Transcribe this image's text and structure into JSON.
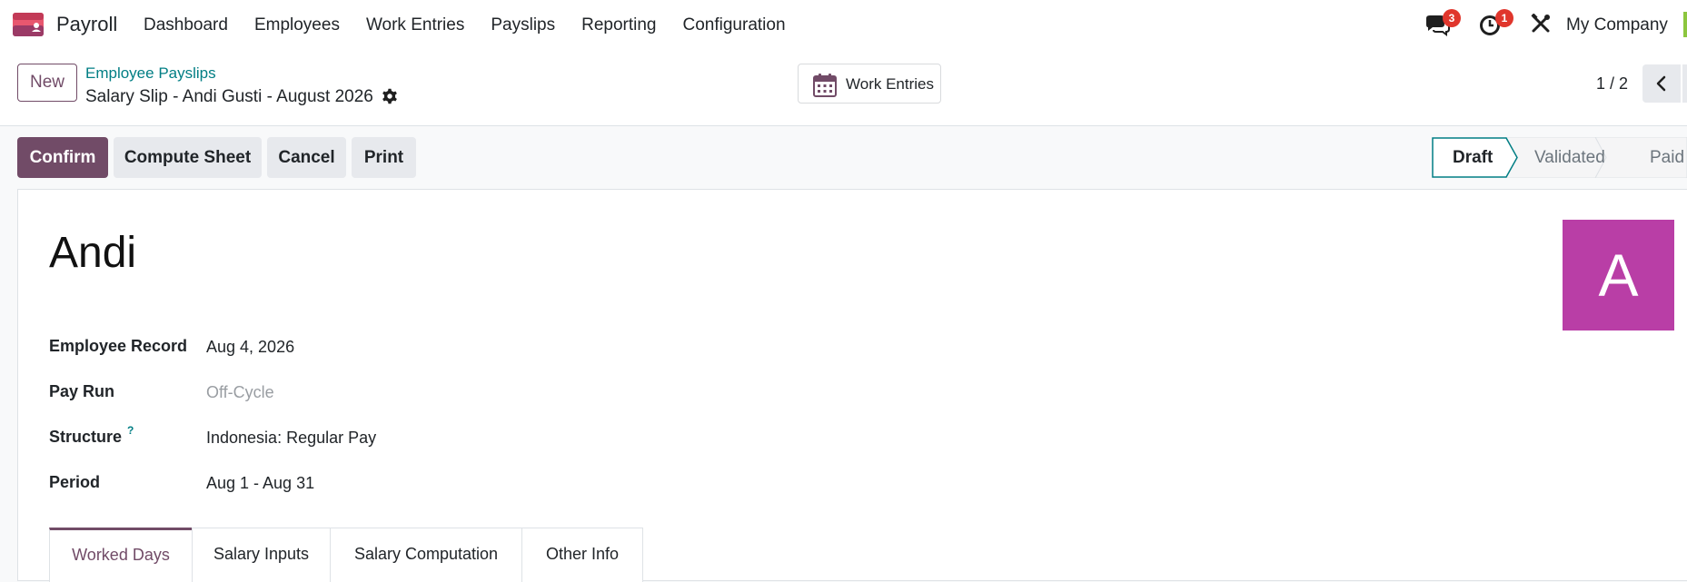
{
  "navbar": {
    "app_name": "Payroll",
    "menu": [
      "Dashboard",
      "Employees",
      "Work Entries",
      "Payslips",
      "Reporting",
      "Configuration"
    ],
    "messages_badge": "3",
    "activities_badge": "1",
    "company": "My Company",
    "icons": [
      "payroll-app-icon",
      "chat-icon",
      "clock-icon",
      "tools-icon"
    ]
  },
  "control_panel": {
    "new_label": "New",
    "breadcrumb_parent": "Employee Payslips",
    "breadcrumb_current": "Salary Slip - Andi Gusti - August 2026",
    "work_entries_label": "Work Entries",
    "pager": "1 / 2"
  },
  "statusbar": {
    "buttons": [
      "Confirm",
      "Compute Sheet",
      "Cancel",
      "Print"
    ],
    "stages": [
      "Draft",
      "Validated",
      "Paid"
    ],
    "current_stage": "Draft"
  },
  "sheet": {
    "employee_name": "Andi",
    "avatar_letter": "A",
    "fields": [
      {
        "label": "Employee Record",
        "value": "Aug 4, 2026"
      },
      {
        "label": "Pay Run",
        "value": "Off-Cycle"
      },
      {
        "label": "Structure",
        "value": "Indonesia: Regular Pay",
        "help": "?"
      },
      {
        "label": "Period",
        "value": "Aug 1 - Aug 31"
      }
    ],
    "tabs": [
      "Worked Days",
      "Salary Inputs",
      "Salary Computation",
      "Other Info"
    ],
    "active_tab": "Worked Days"
  },
  "colors": {
    "brand": "#714b67",
    "link": "#017e84",
    "avatar": "#b93ea6",
    "badge": "#e0362c"
  }
}
